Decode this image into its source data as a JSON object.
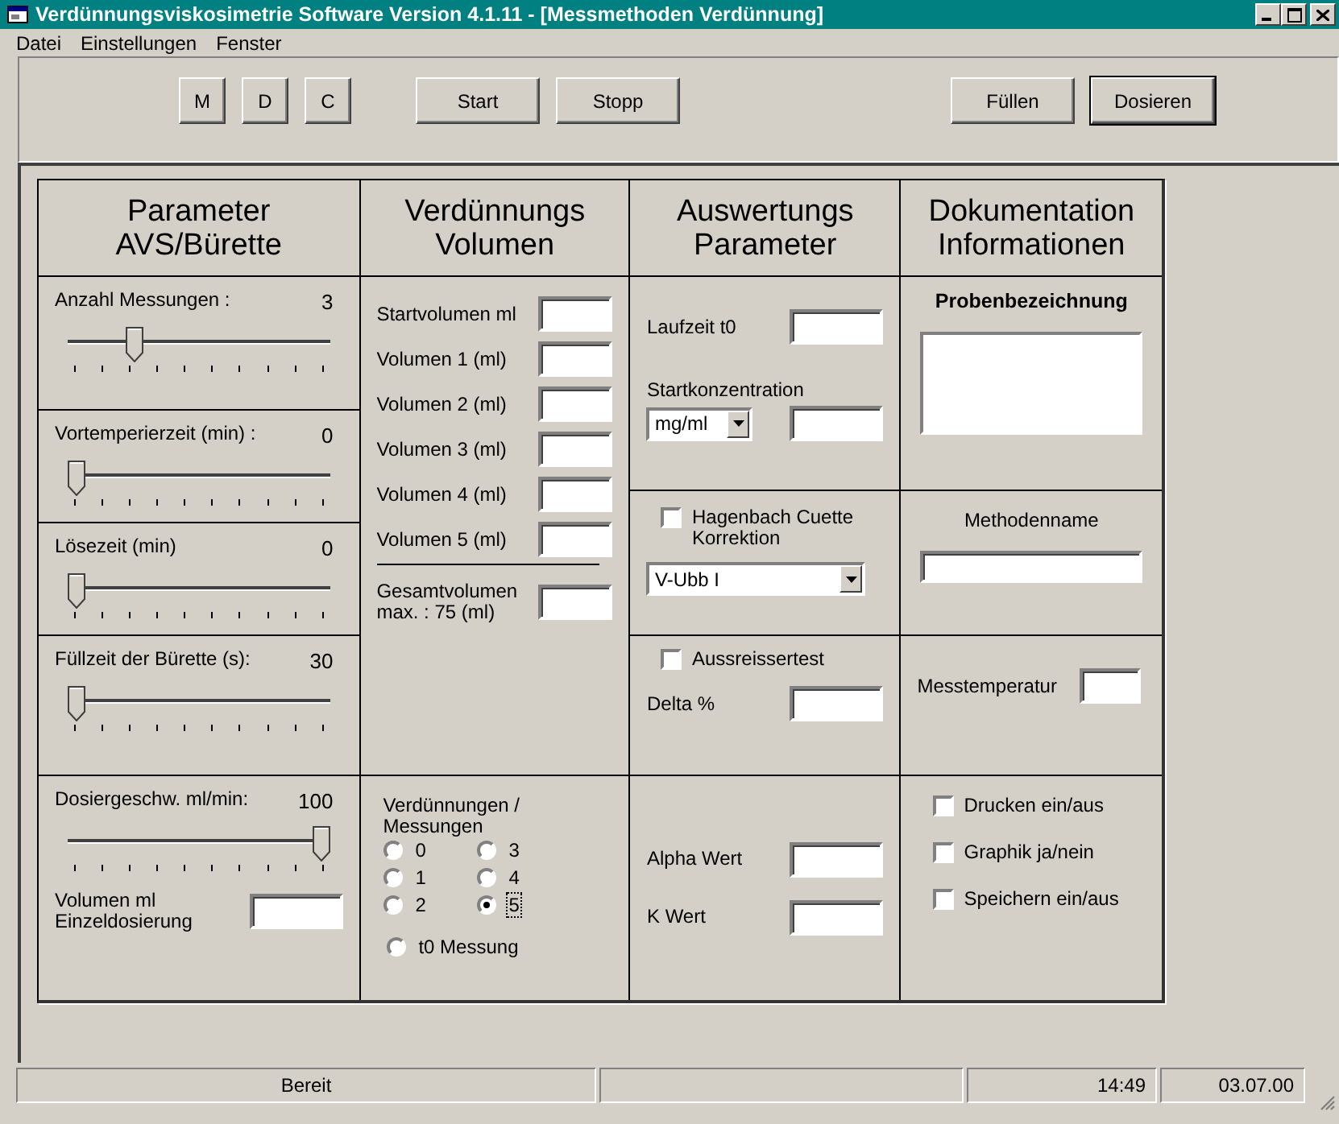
{
  "window": {
    "title": "Verdünnungsviskosimetrie Software Version 4.1.11 - [Messmethoden Verdünnung]"
  },
  "menu": [
    "Datei",
    "Einstellungen",
    "Fenster"
  ],
  "toolbar": {
    "groups": [
      {
        "kind": "small",
        "buttons": [
          {
            "label": "M",
            "default": false
          },
          {
            "label": "D",
            "default": false
          },
          {
            "label": "C",
            "default": false
          }
        ]
      },
      {
        "kind": "wide",
        "buttons": [
          {
            "label": "Start",
            "default": false
          },
          {
            "label": "Stopp",
            "default": false
          }
        ]
      },
      {
        "kind": "right",
        "buttons": [
          {
            "label": "Füllen",
            "default": false
          },
          {
            "label": "Dosieren",
            "default": true
          }
        ]
      }
    ]
  },
  "columns": [
    {
      "title_lines": [
        "Parameter",
        "AVS/Bürette"
      ],
      "sections": [
        {
          "items": [
            {
              "kind": "slider",
              "label": "Anzahl Messungen :",
              "value": "3",
              "level": 0.24
            }
          ]
        },
        {
          "items": [
            {
              "kind": "slider",
              "label": "Vortemperierzeit (min) :",
              "value": "0",
              "level": 0
            }
          ]
        },
        {
          "items": [
            {
              "kind": "slider",
              "label": "Lösezeit (min)",
              "value": "0",
              "level": 0
            }
          ]
        },
        {
          "items": [
            {
              "kind": "slider",
              "label": "Füllzeit der Bürette (s):",
              "value": "30",
              "level": 0
            }
          ]
        },
        {
          "items": [
            {
              "kind": "slider",
              "label": "Dosiergeschw. ml/min:",
              "value": "100",
              "level": 1
            },
            {
              "kind": "field",
              "label_lines": [
                "Volumen ml",
                "Einzeldosierung"
              ]
            }
          ]
        }
      ]
    },
    {
      "title_lines": [
        "Verdünnungs",
        "Volumen"
      ],
      "sections": [
        {
          "items": [
            {
              "kind": "field",
              "label_lines": [
                "Startvolumen ml"
              ]
            },
            {
              "kind": "field",
              "label_lines": [
                "Volumen 1 (ml)"
              ]
            },
            {
              "kind": "field",
              "label_lines": [
                "Volumen 2 (ml)"
              ]
            },
            {
              "kind": "field",
              "label_lines": [
                "Volumen 3 (ml)"
              ]
            },
            {
              "kind": "field",
              "label_lines": [
                "Volumen 4 (ml)"
              ]
            },
            {
              "kind": "field",
              "label_lines": [
                "Volumen 5 (ml)"
              ]
            },
            {
              "kind": "rule"
            },
            {
              "kind": "field",
              "label_lines": [
                "Gesamtvolumen",
                "max. : 75 (ml)"
              ]
            }
          ]
        },
        {
          "items": [
            {
              "kind": "radio-group",
              "label_lines": [
                "Verdünnungen /",
                "Messungen"
              ],
              "options": [
                {
                  "label": "0",
                  "selected": false,
                  "focused": false
                },
                {
                  "label": "3",
                  "selected": false,
                  "focused": false
                },
                {
                  "label": "1",
                  "selected": false,
                  "focused": false
                },
                {
                  "label": "4",
                  "selected": false,
                  "focused": false
                },
                {
                  "label": "2",
                  "selected": false,
                  "focused": false
                },
                {
                  "label": "5",
                  "selected": true,
                  "focused": true
                }
              ]
            },
            {
              "kind": "radio",
              "label": "t0 Messung",
              "selected": false
            }
          ]
        }
      ]
    },
    {
      "title_lines": [
        "Auswertungs",
        "Parameter"
      ],
      "sections": [
        {
          "items": [
            {
              "kind": "field",
              "label_lines": [
                "Laufzeit t0"
              ]
            },
            {
              "kind": "text",
              "label": "Startkonzentration"
            },
            {
              "kind": "combo-field",
              "value": "mg/ml"
            }
          ]
        },
        {
          "items": [
            {
              "kind": "checkbox",
              "label": "Hagenbach Cuette Korrektion",
              "checked": false
            },
            {
              "kind": "combo",
              "value": "V-Ubb I"
            }
          ]
        },
        {
          "items": [
            {
              "kind": "checkbox",
              "label": "Aussreissertest",
              "checked": false
            },
            {
              "kind": "field",
              "label_lines": [
                "Delta %"
              ]
            }
          ]
        },
        {
          "items": [
            {
              "kind": "field",
              "label_lines": [
                "Alpha Wert"
              ]
            },
            {
              "kind": "field",
              "label_lines": [
                "K Wert"
              ]
            }
          ]
        }
      ]
    },
    {
      "title_lines": [
        "Dokumentation",
        "Informationen"
      ],
      "sections": [
        {
          "items": [
            {
              "kind": "heading",
              "label": "Probenbezeichnung"
            },
            {
              "kind": "textarea"
            }
          ]
        },
        {
          "items": [
            {
              "kind": "stacked-field",
              "label": "Methodenname"
            }
          ]
        },
        {
          "items": [
            {
              "kind": "field",
              "label_lines": [
                "Messtemperatur"
              ]
            }
          ]
        },
        {
          "items": [
            {
              "kind": "checkbox",
              "label": "Drucken ein/aus",
              "checked": false
            },
            {
              "kind": "checkbox",
              "label": "Graphik ja/nein",
              "checked": false
            },
            {
              "kind": "checkbox",
              "label": "Speichern ein/aus",
              "checked": false
            }
          ]
        }
      ]
    }
  ],
  "status_bar": {
    "panels": [
      {
        "kind": "center",
        "text": "Bereit"
      },
      {
        "kind": "empty"
      },
      {
        "kind": "right",
        "text": "14:49"
      },
      {
        "kind": "right",
        "text": "03.07.00"
      }
    ]
  }
}
